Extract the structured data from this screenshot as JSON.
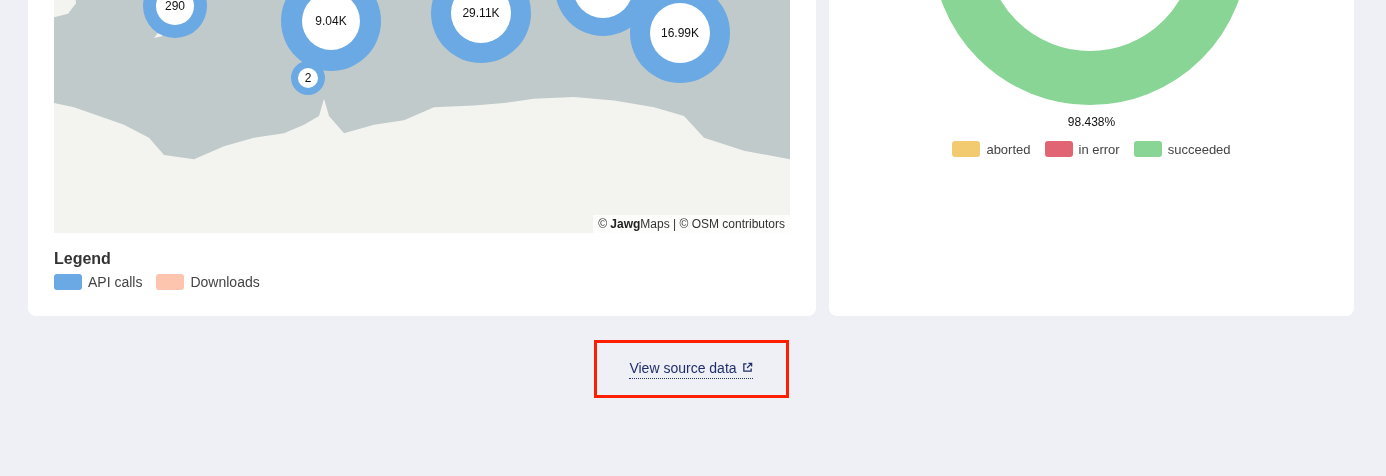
{
  "map_panel": {
    "markers": [
      {
        "kind": "labeled",
        "label": "290"
      },
      {
        "kind": "labeled",
        "label": "9.04K"
      },
      {
        "kind": "labeled",
        "label": "29.11K"
      },
      {
        "kind": "plain"
      },
      {
        "kind": "labeled",
        "label": "16.99K"
      },
      {
        "kind": "labeled",
        "label": "2"
      }
    ],
    "attribution": "© **Jawg**Maps | © OSM contributors",
    "legend": {
      "title": "Legend",
      "items": [
        {
          "label": "API calls",
          "color": "#6aa9e4"
        },
        {
          "label": "Downloads",
          "color": "#fdc5ae"
        }
      ]
    }
  },
  "status_panel": {
    "ring_label": "98.438%",
    "legend": [
      {
        "label": "aborted",
        "color": "#f2cb70"
      },
      {
        "label": "in error",
        "color": "#e06474"
      },
      {
        "label": "succeeded",
        "color": "#88d595"
      }
    ]
  },
  "source_link": {
    "label": "View source data",
    "highlighted": true
  }
}
